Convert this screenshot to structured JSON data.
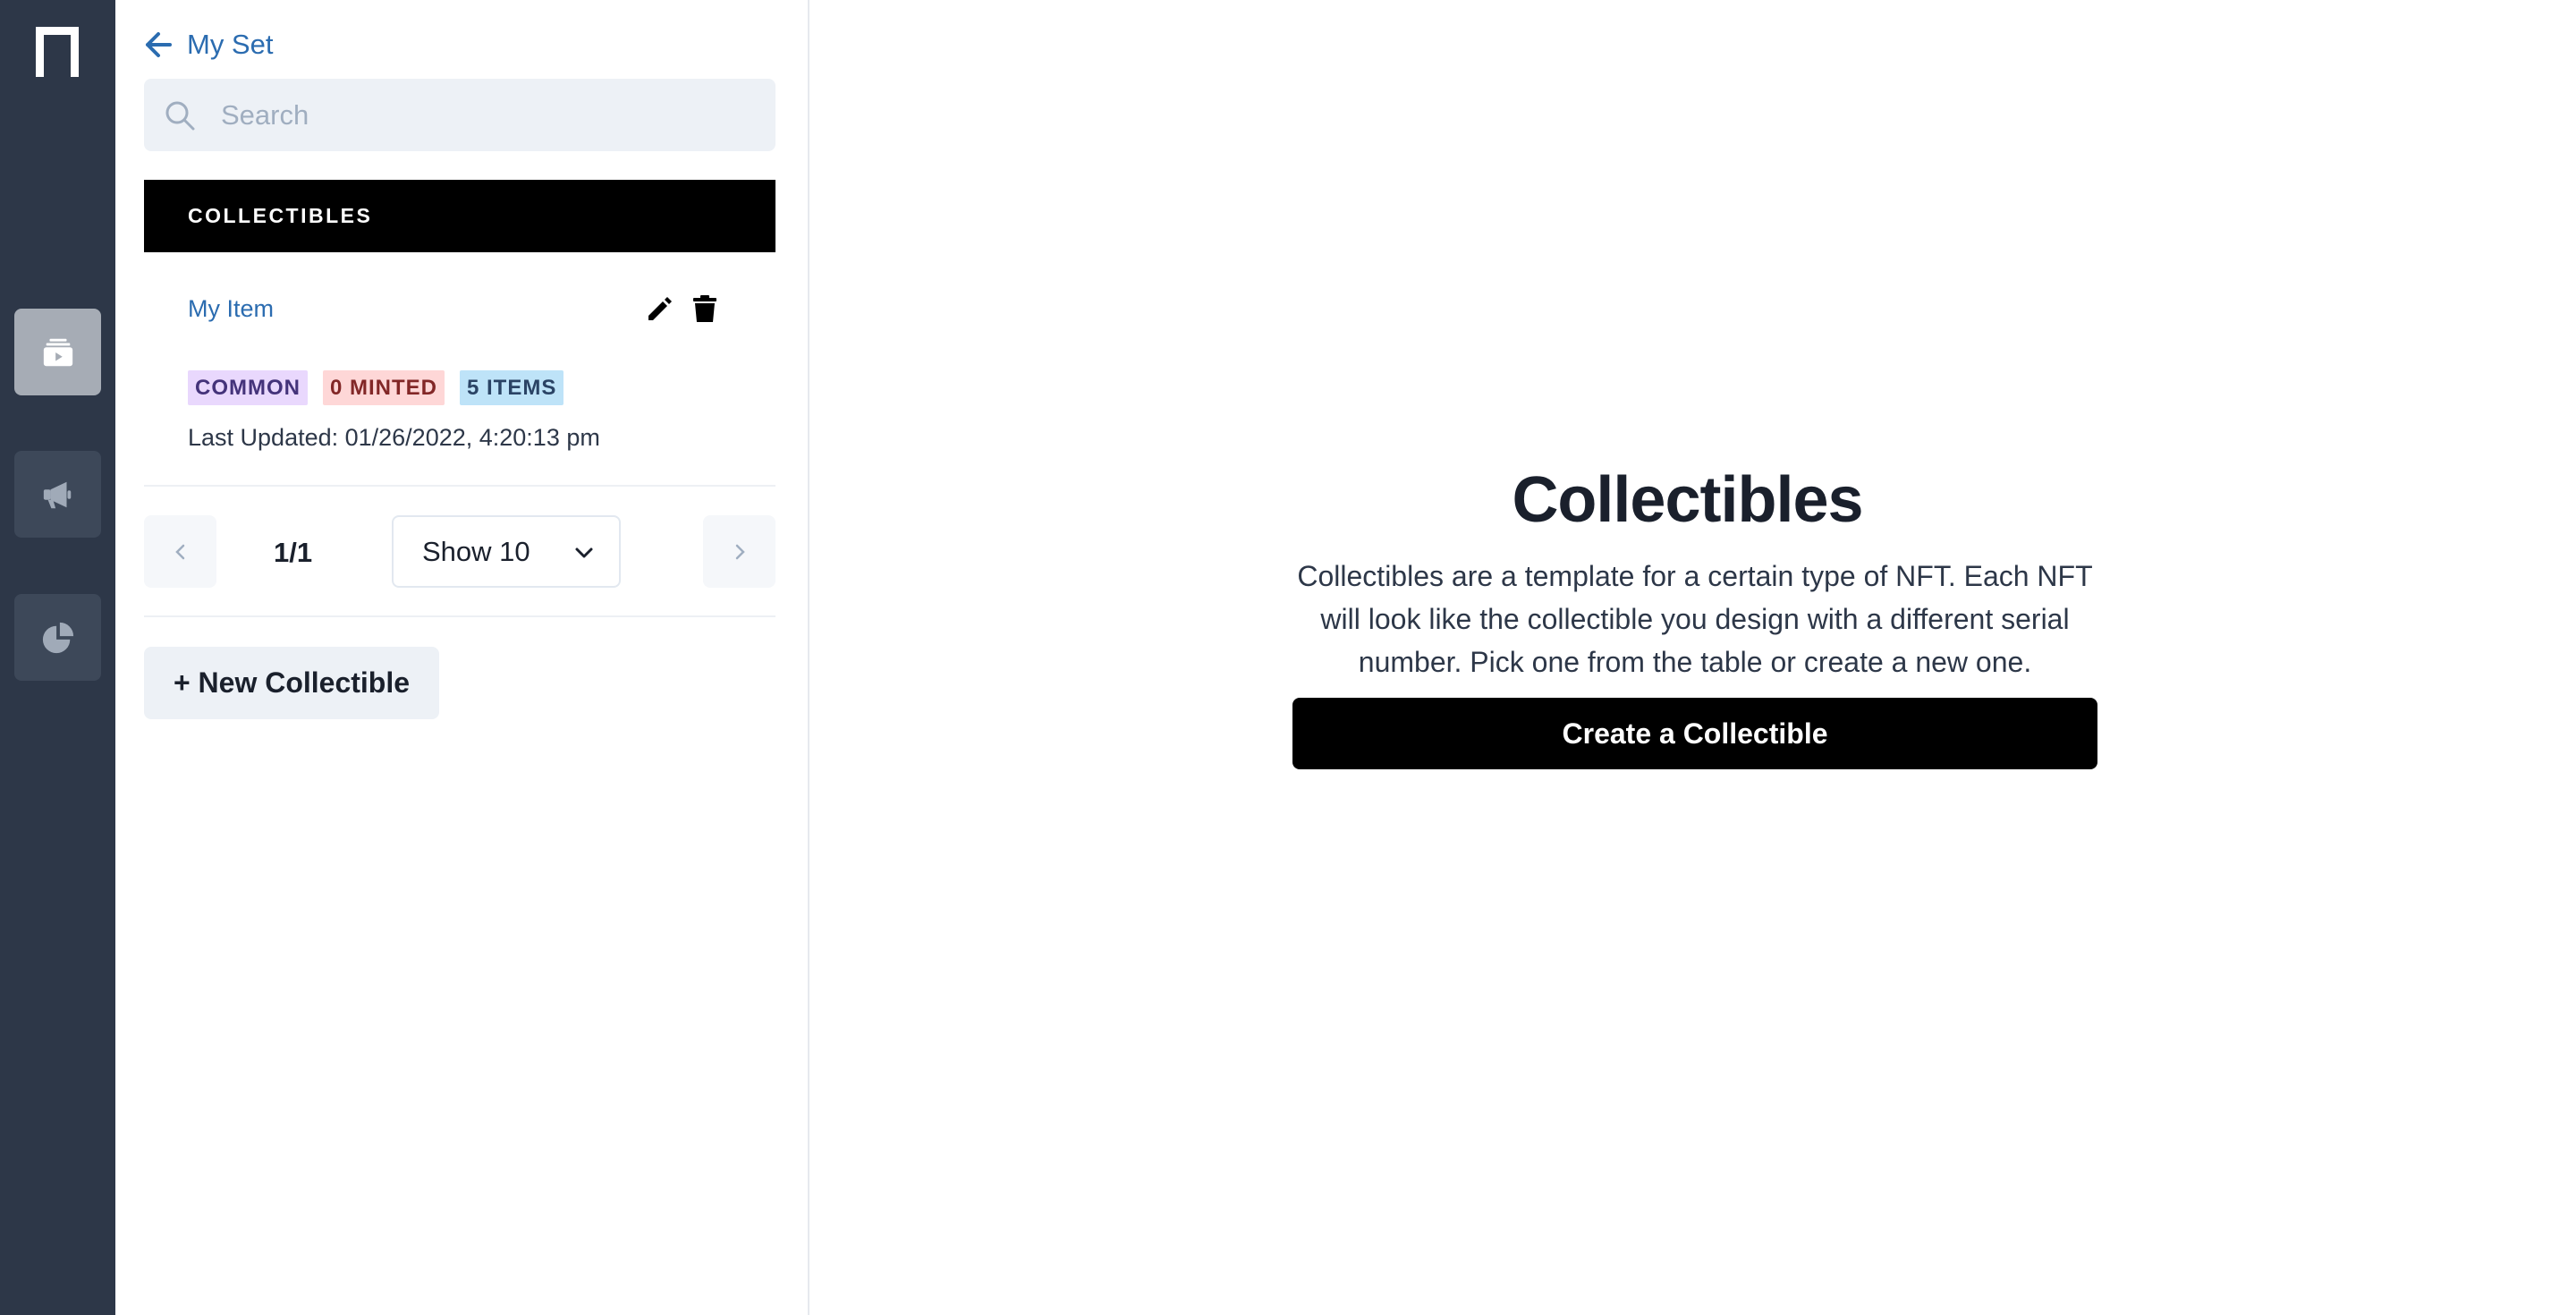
{
  "rail": {
    "logo": "n-logo",
    "items": [
      {
        "name": "collectibles",
        "icon": "ticket-icon",
        "active": true
      },
      {
        "name": "campaigns",
        "icon": "megaphone-icon",
        "active": false
      },
      {
        "name": "analytics",
        "icon": "pie-chart-icon",
        "active": false
      }
    ]
  },
  "panel": {
    "back_label": "My Set",
    "search_placeholder": "Search",
    "section_title": "COLLECTIBLES",
    "items": [
      {
        "name": "My Item",
        "badges": [
          "COMMON",
          "0 MINTED",
          "5 ITEMS"
        ],
        "last_updated": "Last Updated: 01/26/2022, 4:20:13 pm"
      }
    ],
    "pagination": {
      "page_label": "1/1",
      "show_label": "Show 10"
    },
    "new_button": "+ New Collectible"
  },
  "main": {
    "title": "Collectibles",
    "description": "Collectibles are a template for a certain type of NFT. Each NFT will look like the collectible you design with a different serial number. Pick one from the table or create a new one.",
    "create_button": "Create a Collectible"
  },
  "colors": {
    "rail_bg": "#2d3748",
    "link": "#2b6cb0",
    "header_bg": "#000000",
    "badge_common": "#e9d8fd",
    "badge_minted": "#fed7d7",
    "badge_items": "#bee3f8"
  }
}
